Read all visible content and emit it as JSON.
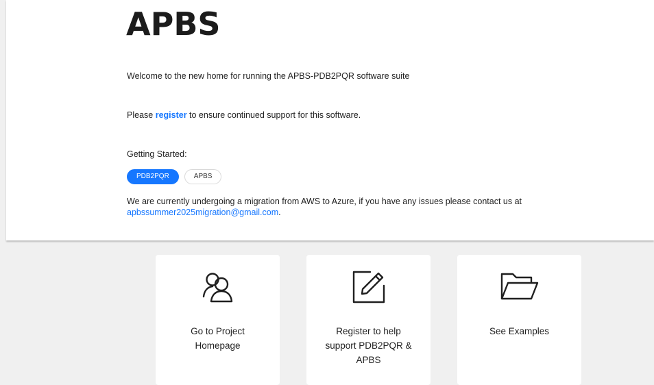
{
  "header": {
    "title": "APBS"
  },
  "intro": {
    "welcome": "Welcome to the new home for running the APBS-PDB2PQR software suite",
    "register_prefix": "Please ",
    "register_link": "register",
    "register_suffix": " to ensure continued support for this software."
  },
  "getting_started": {
    "label": "Getting Started:",
    "tabs": [
      {
        "label": "PDB2PQR",
        "active": true
      },
      {
        "label": "APBS",
        "active": false
      }
    ]
  },
  "notice": {
    "text": "We are currently undergoing a migration from AWS to Azure, if you have any issues please contact us at",
    "email": "apbssummer2025migration@gmail.com",
    "suffix": "."
  },
  "cards": [
    {
      "icon": "users-icon",
      "label_line1": "Go to Project",
      "label_line2": "Homepage",
      "label_line3": ""
    },
    {
      "icon": "edit-icon",
      "label_line1": "Register to help",
      "label_line2": "support PDB2PQR &",
      "label_line3": "APBS"
    },
    {
      "icon": "folder-open-icon",
      "label_line1": "See Examples",
      "label_line2": "",
      "label_line3": ""
    }
  ],
  "colors": {
    "accent": "#1677ff",
    "background": "#f0f0f0",
    "panel": "#ffffff"
  }
}
